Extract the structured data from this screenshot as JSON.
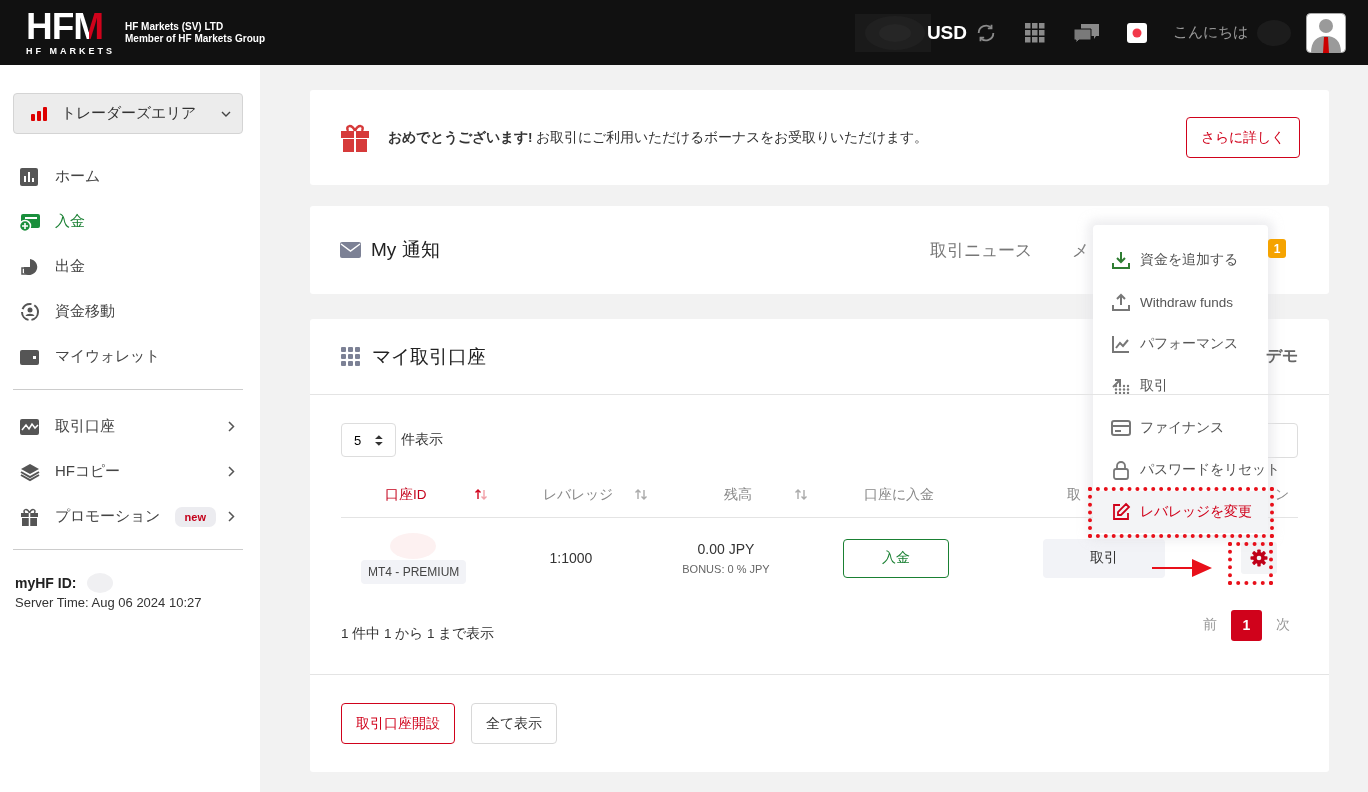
{
  "header": {
    "logo": "HFM",
    "logo_subtitle": "HF MARKETS",
    "company": "HF Markets (SV) LTD",
    "group": "Member of HF Markets Group",
    "currency": "USD",
    "greeting": "こんにちは"
  },
  "sidebar": {
    "area_selector": "トレーダーズエリア",
    "sections": [
      [
        {
          "label": "ホーム",
          "selected": false,
          "has_submenu": false
        },
        {
          "label": "入金",
          "selected": true,
          "has_submenu": false
        },
        {
          "label": "出金",
          "selected": false,
          "has_submenu": false
        },
        {
          "label": "資金移動",
          "selected": false,
          "has_submenu": false
        },
        {
          "label": "マイウォレット",
          "selected": false,
          "has_submenu": false
        }
      ],
      [
        {
          "label": "取引口座",
          "selected": false,
          "has_submenu": true
        },
        {
          "label": "HFコピー",
          "selected": false,
          "has_submenu": true
        },
        {
          "label": "プロモーション",
          "selected": false,
          "has_submenu": true,
          "badge": "new"
        }
      ]
    ],
    "id_label": "myHF ID:",
    "server_time": "Server Time: Aug 06 2024 10:27"
  },
  "bonus_banner": {
    "text": "**おめでとうございます!** お取引にご利用いただけるボーナスをお受取りいただけます。",
    "button": "さらに詳しく"
  },
  "notifications": {
    "title": "My 通知",
    "tabs": [
      "取引ニュース",
      "メ"
    ],
    "badge": "1"
  },
  "accounts": {
    "title": "マイ取引口座",
    "tab": "デモ",
    "page_size": "5",
    "page_size_label": "件表示",
    "columns": [
      {
        "label": "口座ID",
        "sorted": true,
        "selected": true
      },
      {
        "label": "レバレッジ",
        "sorted": false,
        "selected": false
      },
      {
        "label": "残高",
        "sorted": false,
        "selected": false
      },
      {
        "label": "口座に入金",
        "selected": false
      },
      {
        "label": "取",
        "selected": false
      },
      {
        "label": "ン",
        "selected": false
      }
    ],
    "rows": [
      {
        "account_type": "MT4 - PREMIUM",
        "leverage": "1:1000",
        "balance": "0.00 JPY",
        "bonus": "BONUS: 0 % JPY",
        "deposit_button": "入金",
        "trade_button": "取引"
      }
    ],
    "summary": "1 件中 1 から 1 まで表示",
    "prev": "前",
    "pages": [
      {
        "label": "1",
        "selected": true
      }
    ],
    "next": "次",
    "buttons": [
      "取引口座開設",
      "全て表示"
    ]
  },
  "action_menu": {
    "items": [
      {
        "label": "資金を追加する",
        "selected": false
      },
      {
        "label": "Withdraw funds",
        "selected": false
      },
      {
        "label": "パフォーマンス",
        "selected": false
      },
      {
        "label": "取引",
        "selected": false
      },
      {
        "label": "ファイナンス",
        "selected": false
      },
      {
        "label": "パスワードをリセット",
        "selected": false
      },
      {
        "label": "レバレッジを変更",
        "selected": true
      }
    ]
  }
}
